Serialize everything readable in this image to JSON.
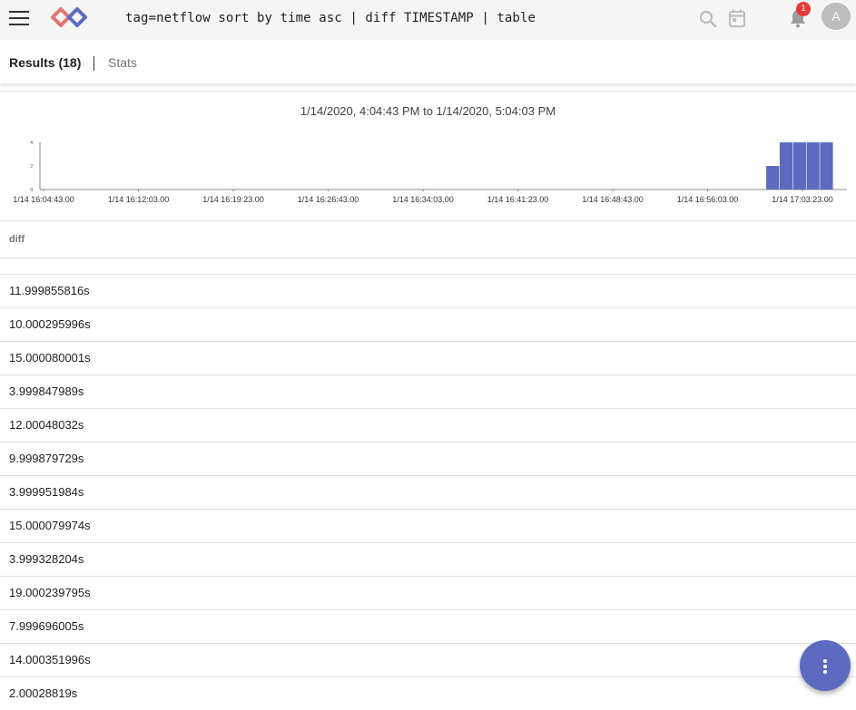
{
  "header": {
    "query": "tag=netflow sort by time asc | diff TIMESTAMP | table",
    "notification_count": "1",
    "avatar_initial": "A"
  },
  "tabs": {
    "results_label": "Results (18)",
    "stats_label": "Stats"
  },
  "range": {
    "text": "1/14/2020, 4:04:43 PM to 1/14/2020, 5:04:03 PM"
  },
  "chart_data": {
    "type": "bar",
    "y_ticks": [
      "4",
      "2",
      "0"
    ],
    "ylim": [
      0,
      4
    ],
    "x_tick_labels": [
      "1/14 16:04:43.00",
      "1/14 16:12:03.00",
      "1/14 16:19:23.00",
      "1/14 16:26:43.00",
      "1/14 16:34:03.00",
      "1/14 16:41:23.00",
      "1/14 16:48:43.00",
      "1/14 16:56:03.00",
      "1/14 17:03:23.00"
    ],
    "bins": 60,
    "values": [
      0,
      0,
      0,
      0,
      0,
      0,
      0,
      0,
      0,
      0,
      0,
      0,
      0,
      0,
      0,
      0,
      0,
      0,
      0,
      0,
      0,
      0,
      0,
      0,
      0,
      0,
      0,
      0,
      0,
      0,
      0,
      0,
      0,
      0,
      0,
      0,
      0,
      0,
      0,
      0,
      0,
      0,
      0,
      0,
      0,
      0,
      0,
      0,
      0,
      0,
      0,
      0,
      0,
      0,
      2,
      4,
      4,
      4,
      4,
      0
    ],
    "bar_color": "#5c6bc0"
  },
  "table": {
    "column": "diff",
    "rows": [
      "11.999855816s",
      "10.000295996s",
      "15.000080001s",
      "3.999847989s",
      "12.00048032s",
      "9.999879729s",
      "3.999951984s",
      "15.000079974s",
      "3.999328204s",
      "19.000239795s",
      "7.999696005s",
      "14.000351996s",
      "2.00028819s"
    ]
  }
}
